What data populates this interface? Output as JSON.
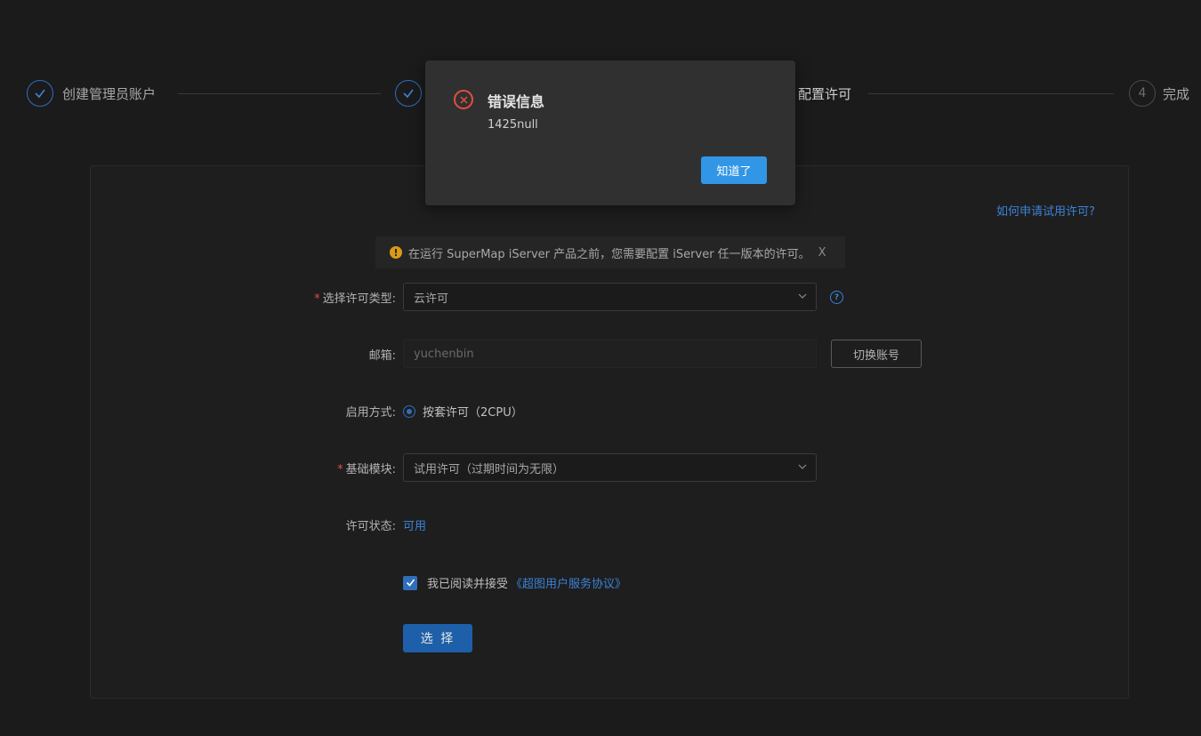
{
  "steps": [
    {
      "index": "1",
      "title": "创建管理员账户",
      "status": "done"
    },
    {
      "index": "2",
      "title": "",
      "status": "done"
    },
    {
      "index": "3",
      "title": "配置许可",
      "status": "active"
    },
    {
      "index": "4",
      "title": "完成",
      "status": "pending"
    }
  ],
  "help_link": "如何申请试用许可?",
  "alert": {
    "icon": "warning-icon",
    "text": "在运行 SuperMap iServer 产品之前，您需要配置 iServer 任一版本的许可。",
    "close": "X"
  },
  "form": {
    "license_type_label": "选择许可类型:",
    "license_type_value": "云许可",
    "email_label": "邮箱:",
    "email_value": "yuchenbin",
    "switch_account": "切换账号",
    "activation_label": "启用方式:",
    "activation_option": "按套许可（2CPU）",
    "base_module_label": "基础模块:",
    "base_module_value": "试用许可（过期时间为无限）",
    "status_label": "许可状态:",
    "status_value": "可用",
    "agreement_text": "我已阅读并接受",
    "agreement_link": "《超图用户服务协议》",
    "submit": "选 择"
  },
  "modal": {
    "title": "错误信息",
    "message": "1425null",
    "ok": "知道了",
    "icon": "error-circle-icon"
  },
  "colors": {
    "accent": "#3a83d6",
    "primary_button": "#1d5fa8",
    "modal_button": "#3296e6",
    "error": "#e0503c",
    "warning": "#d99a17"
  }
}
